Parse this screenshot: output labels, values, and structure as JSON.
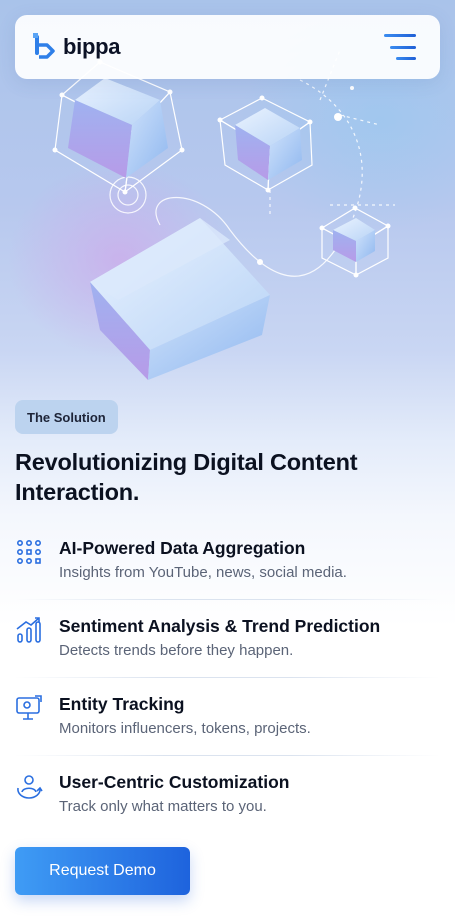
{
  "brand": {
    "name": "bippa"
  },
  "hero": {
    "badge": "The Solution",
    "heading": "Revolutionizing Digital Content Interaction."
  },
  "features": [
    {
      "icon": "data-grid-icon",
      "title": "AI-Powered Data Aggregation",
      "desc": "Insights from YouTube, news, social media."
    },
    {
      "icon": "bar-chart-trend-icon",
      "title": "Sentiment Analysis & Trend Prediction",
      "desc": "Detects trends before they happen."
    },
    {
      "icon": "monitor-tracking-icon",
      "title": "Entity Tracking",
      "desc": "Monitors influencers, tokens, projects."
    },
    {
      "icon": "user-sync-icon",
      "title": "User-Centric Customization",
      "desc": "Track only what matters to you."
    }
  ],
  "cta": {
    "label": "Request Demo"
  },
  "colors": {
    "accent": "#1e63dd",
    "accent_light": "#3f9cf5",
    "badge_bg": "#bcd3ef"
  }
}
